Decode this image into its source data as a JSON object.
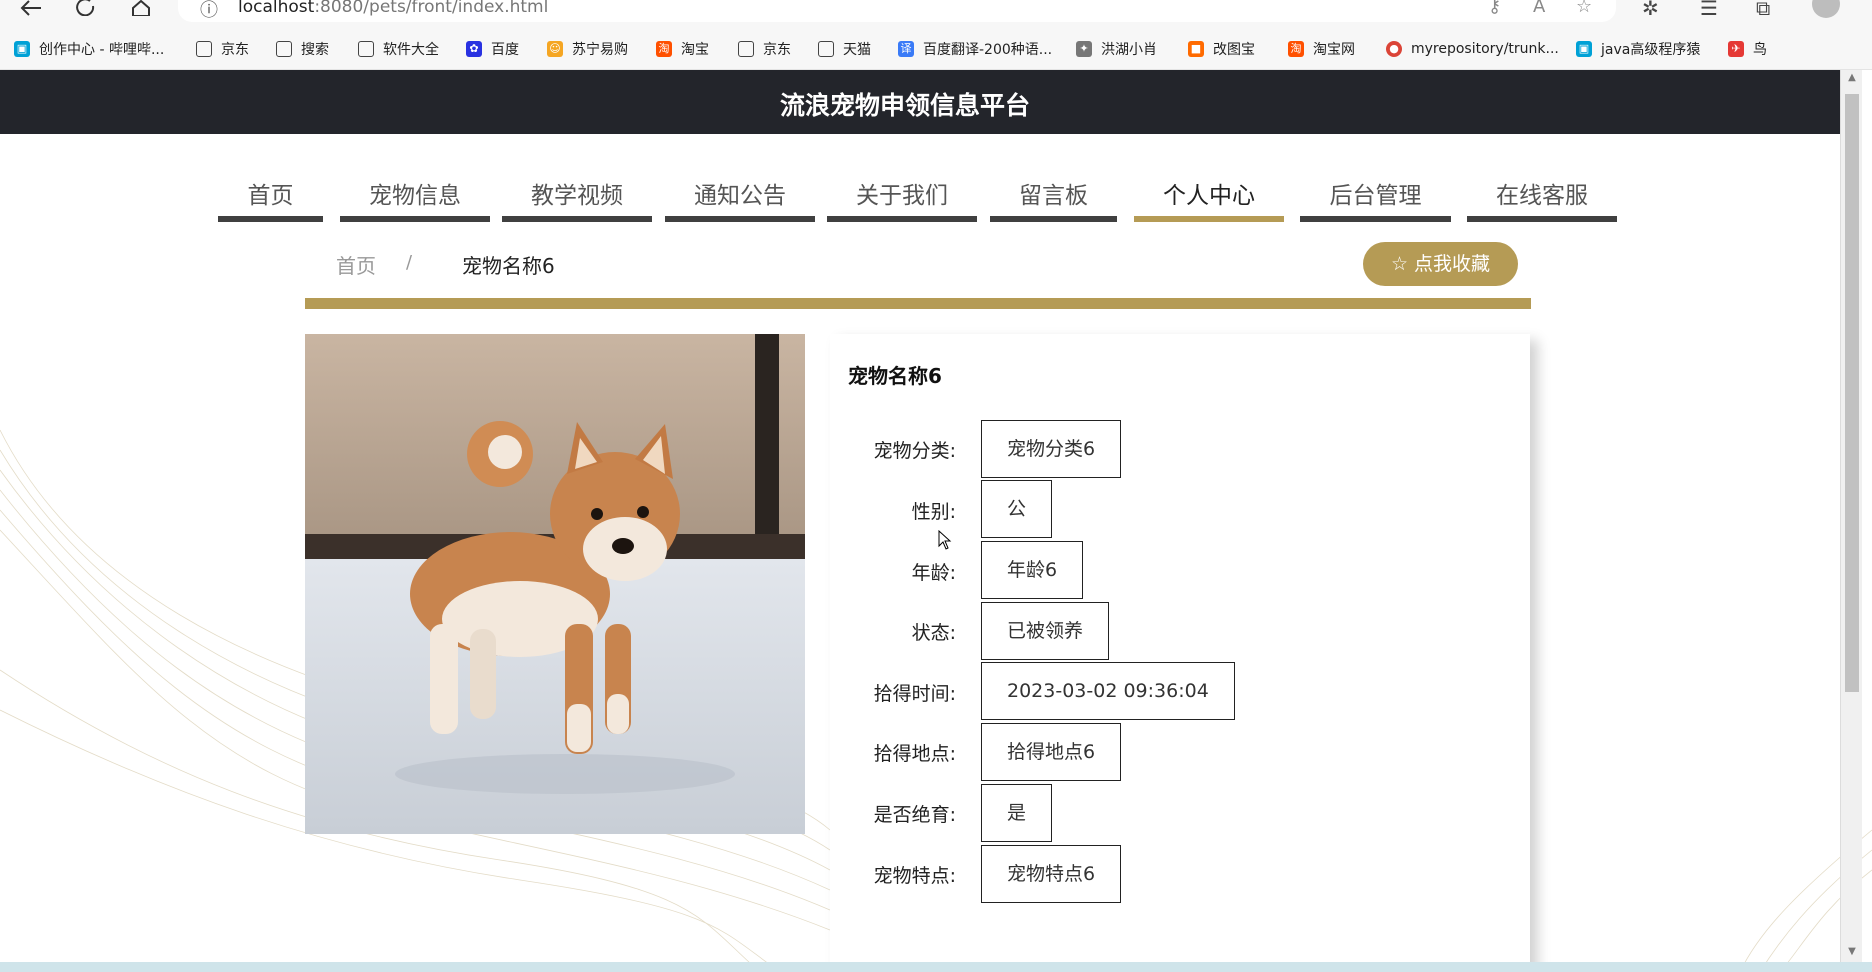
{
  "browser": {
    "url_host": "localhost",
    "url_rest": ":8080/pets/front/index.html",
    "bookmarks": [
      {
        "label": "创作中心 - 哔哩哔...",
        "icon": "bilibili-icon",
        "color": "#00a1d6"
      },
      {
        "label": "京东",
        "icon": "page-icon",
        "color": "#ffffff"
      },
      {
        "label": "搜索",
        "icon": "page-icon",
        "color": "#ffffff"
      },
      {
        "label": "软件大全",
        "icon": "page-icon",
        "color": "#ffffff"
      },
      {
        "label": "百度",
        "icon": "baidu-icon",
        "color": "#2932e1"
      },
      {
        "label": "苏宁易购",
        "icon": "suning-icon",
        "color": "#f5a623"
      },
      {
        "label": "淘宝",
        "icon": "taobao-icon",
        "color": "#ff5000"
      },
      {
        "label": "京东",
        "icon": "page-icon",
        "color": "#ffffff"
      },
      {
        "label": "天猫",
        "icon": "page-icon",
        "color": "#ffffff"
      },
      {
        "label": "百度翻译-200种语...",
        "icon": "baidu-translate-icon",
        "color": "#3a7bf7"
      },
      {
        "label": "洪湖小肖",
        "icon": "bird-icon",
        "color": "#777777"
      },
      {
        "label": "改图宝",
        "icon": "gaitubao-icon",
        "color": "#ff6a00"
      },
      {
        "label": "淘宝网",
        "icon": "taobao-icon",
        "color": "#ff5000"
      },
      {
        "label": "myrepository/trunk...",
        "icon": "chrome-icon",
        "color": "#db4437"
      },
      {
        "label": "java高级程序猿",
        "icon": "bilibili-icon",
        "color": "#00a1d6"
      },
      {
        "label": "鸟",
        "icon": "bird-icon",
        "color": "#e53935"
      }
    ]
  },
  "site": {
    "title": "流浪宠物申领信息平台"
  },
  "menu": [
    {
      "label": "首页",
      "active": false
    },
    {
      "label": "宠物信息",
      "active": false
    },
    {
      "label": "教学视频",
      "active": false
    },
    {
      "label": "通知公告",
      "active": false
    },
    {
      "label": "关于我们",
      "active": false
    },
    {
      "label": "留言板",
      "active": false
    },
    {
      "label": "个人中心",
      "active": true
    },
    {
      "label": "后台管理",
      "active": false
    },
    {
      "label": "在线客服",
      "active": false
    }
  ],
  "breadcrumb": {
    "home": "首页",
    "separator": "/",
    "current": "宠物名称6"
  },
  "favorite_button": {
    "icon": "star-outline-icon",
    "label": "☆ 点我收藏"
  },
  "pet": {
    "name": "宠物名称6",
    "fields": [
      {
        "label": "宠物分类:",
        "value": "宠物分类6"
      },
      {
        "label": "性别:",
        "value": "公"
      },
      {
        "label": "年龄:",
        "value": "年龄6"
      },
      {
        "label": "状态:",
        "value": "已被领养"
      },
      {
        "label": "拾得时间:",
        "value": "2023-03-02 09:36:04"
      },
      {
        "label": "拾得地点:",
        "value": "拾得地点6"
      },
      {
        "label": "是否绝育:",
        "value": "是"
      },
      {
        "label": "宠物特点:",
        "value": "宠物特点6"
      }
    ]
  },
  "colors": {
    "accent": "#b59b55",
    "header_bg": "#23252b",
    "menu_underline": "#404040"
  }
}
